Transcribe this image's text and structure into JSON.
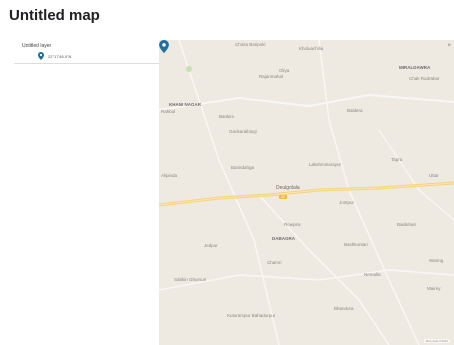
{
  "title": "Untitled map",
  "layer": {
    "name": "Untitled layer",
    "item_label": "22°17'46.0\"N"
  },
  "map": {
    "places": [
      {
        "text": "Chinta Baripoki",
        "style": "normal"
      },
      {
        "text": "Kholuachilia",
        "style": "normal"
      },
      {
        "text": "Oliya",
        "style": "normal"
      },
      {
        "text": "Rajanmahal",
        "style": "normal"
      },
      {
        "text": "MIRALDAWRA",
        "style": "bold"
      },
      {
        "text": "Chak Rudrabar",
        "style": "normal"
      },
      {
        "text": "KHANI NAGAR",
        "style": "bold"
      },
      {
        "text": "Rahbul",
        "style": "normal"
      },
      {
        "text": "Bankim",
        "style": "normal"
      },
      {
        "text": "Baldera",
        "style": "normal"
      },
      {
        "text": "Garikaralbingi",
        "style": "normal"
      },
      {
        "text": "Banirdahga",
        "style": "normal"
      },
      {
        "text": "Lakshminarayur",
        "style": "normal"
      },
      {
        "text": "Tapra",
        "style": "normal"
      },
      {
        "text": "Alipinda",
        "style": "normal"
      },
      {
        "text": "Uttar",
        "style": "normal"
      },
      {
        "text": "Deulgolala",
        "style": "dark"
      },
      {
        "text": "Jontpur",
        "style": "normal"
      },
      {
        "text": "Baidehari",
        "style": "normal"
      },
      {
        "text": "Rowpira",
        "style": "normal"
      },
      {
        "text": "Jedpur",
        "style": "normal"
      },
      {
        "text": "DABAGRA",
        "style": "bold"
      },
      {
        "text": "Bashkuntari",
        "style": "normal"
      },
      {
        "text": "Chamri",
        "style": "normal"
      },
      {
        "text": "Waring",
        "style": "normal"
      },
      {
        "text": "Nemalla",
        "style": "normal"
      },
      {
        "text": "Sabkin Ghursuri",
        "style": "normal"
      },
      {
        "text": "Mairey",
        "style": "normal"
      },
      {
        "text": "Bhandora",
        "style": "normal"
      },
      {
        "text": "Kuturampur Bahadurpur",
        "style": "normal"
      }
    ],
    "road_badge": "22",
    "close_glyph": "×",
    "attribution": "Map data ©2023"
  },
  "colors": {
    "map_bg": "#efeae1",
    "road": "#f6d27e",
    "marker": "#1f6f9f",
    "divider": "#dddddd"
  },
  "icons": {
    "layer_item": "map-pin-icon",
    "map_marker": "map-pin-icon"
  }
}
